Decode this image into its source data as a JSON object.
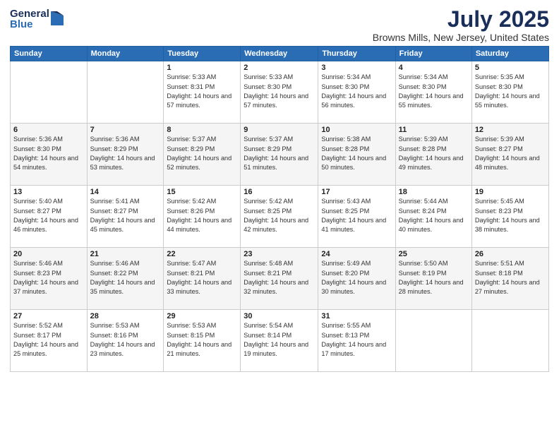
{
  "header": {
    "logo": {
      "general": "General",
      "blue": "Blue"
    },
    "title": "July 2025",
    "location": "Browns Mills, New Jersey, United States"
  },
  "weekdays": [
    "Sunday",
    "Monday",
    "Tuesday",
    "Wednesday",
    "Thursday",
    "Friday",
    "Saturday"
  ],
  "weeks": [
    [
      {
        "day": null
      },
      {
        "day": null
      },
      {
        "day": "1",
        "sunrise": "5:33 AM",
        "sunset": "8:31 PM",
        "daylight": "14 hours and 57 minutes."
      },
      {
        "day": "2",
        "sunrise": "5:33 AM",
        "sunset": "8:30 PM",
        "daylight": "14 hours and 57 minutes."
      },
      {
        "day": "3",
        "sunrise": "5:34 AM",
        "sunset": "8:30 PM",
        "daylight": "14 hours and 56 minutes."
      },
      {
        "day": "4",
        "sunrise": "5:34 AM",
        "sunset": "8:30 PM",
        "daylight": "14 hours and 55 minutes."
      },
      {
        "day": "5",
        "sunrise": "5:35 AM",
        "sunset": "8:30 PM",
        "daylight": "14 hours and 55 minutes."
      }
    ],
    [
      {
        "day": "6",
        "sunrise": "5:36 AM",
        "sunset": "8:30 PM",
        "daylight": "14 hours and 54 minutes."
      },
      {
        "day": "7",
        "sunrise": "5:36 AM",
        "sunset": "8:29 PM",
        "daylight": "14 hours and 53 minutes."
      },
      {
        "day": "8",
        "sunrise": "5:37 AM",
        "sunset": "8:29 PM",
        "daylight": "14 hours and 52 minutes."
      },
      {
        "day": "9",
        "sunrise": "5:37 AM",
        "sunset": "8:29 PM",
        "daylight": "14 hours and 51 minutes."
      },
      {
        "day": "10",
        "sunrise": "5:38 AM",
        "sunset": "8:28 PM",
        "daylight": "14 hours and 50 minutes."
      },
      {
        "day": "11",
        "sunrise": "5:39 AM",
        "sunset": "8:28 PM",
        "daylight": "14 hours and 49 minutes."
      },
      {
        "day": "12",
        "sunrise": "5:39 AM",
        "sunset": "8:27 PM",
        "daylight": "14 hours and 48 minutes."
      }
    ],
    [
      {
        "day": "13",
        "sunrise": "5:40 AM",
        "sunset": "8:27 PM",
        "daylight": "14 hours and 46 minutes."
      },
      {
        "day": "14",
        "sunrise": "5:41 AM",
        "sunset": "8:27 PM",
        "daylight": "14 hours and 45 minutes."
      },
      {
        "day": "15",
        "sunrise": "5:42 AM",
        "sunset": "8:26 PM",
        "daylight": "14 hours and 44 minutes."
      },
      {
        "day": "16",
        "sunrise": "5:42 AM",
        "sunset": "8:25 PM",
        "daylight": "14 hours and 42 minutes."
      },
      {
        "day": "17",
        "sunrise": "5:43 AM",
        "sunset": "8:25 PM",
        "daylight": "14 hours and 41 minutes."
      },
      {
        "day": "18",
        "sunrise": "5:44 AM",
        "sunset": "8:24 PM",
        "daylight": "14 hours and 40 minutes."
      },
      {
        "day": "19",
        "sunrise": "5:45 AM",
        "sunset": "8:23 PM",
        "daylight": "14 hours and 38 minutes."
      }
    ],
    [
      {
        "day": "20",
        "sunrise": "5:46 AM",
        "sunset": "8:23 PM",
        "daylight": "14 hours and 37 minutes."
      },
      {
        "day": "21",
        "sunrise": "5:46 AM",
        "sunset": "8:22 PM",
        "daylight": "14 hours and 35 minutes."
      },
      {
        "day": "22",
        "sunrise": "5:47 AM",
        "sunset": "8:21 PM",
        "daylight": "14 hours and 33 minutes."
      },
      {
        "day": "23",
        "sunrise": "5:48 AM",
        "sunset": "8:21 PM",
        "daylight": "14 hours and 32 minutes."
      },
      {
        "day": "24",
        "sunrise": "5:49 AM",
        "sunset": "8:20 PM",
        "daylight": "14 hours and 30 minutes."
      },
      {
        "day": "25",
        "sunrise": "5:50 AM",
        "sunset": "8:19 PM",
        "daylight": "14 hours and 28 minutes."
      },
      {
        "day": "26",
        "sunrise": "5:51 AM",
        "sunset": "8:18 PM",
        "daylight": "14 hours and 27 minutes."
      }
    ],
    [
      {
        "day": "27",
        "sunrise": "5:52 AM",
        "sunset": "8:17 PM",
        "daylight": "14 hours and 25 minutes."
      },
      {
        "day": "28",
        "sunrise": "5:53 AM",
        "sunset": "8:16 PM",
        "daylight": "14 hours and 23 minutes."
      },
      {
        "day": "29",
        "sunrise": "5:53 AM",
        "sunset": "8:15 PM",
        "daylight": "14 hours and 21 minutes."
      },
      {
        "day": "30",
        "sunrise": "5:54 AM",
        "sunset": "8:14 PM",
        "daylight": "14 hours and 19 minutes."
      },
      {
        "day": "31",
        "sunrise": "5:55 AM",
        "sunset": "8:13 PM",
        "daylight": "14 hours and 17 minutes."
      },
      {
        "day": null
      },
      {
        "day": null
      }
    ]
  ]
}
